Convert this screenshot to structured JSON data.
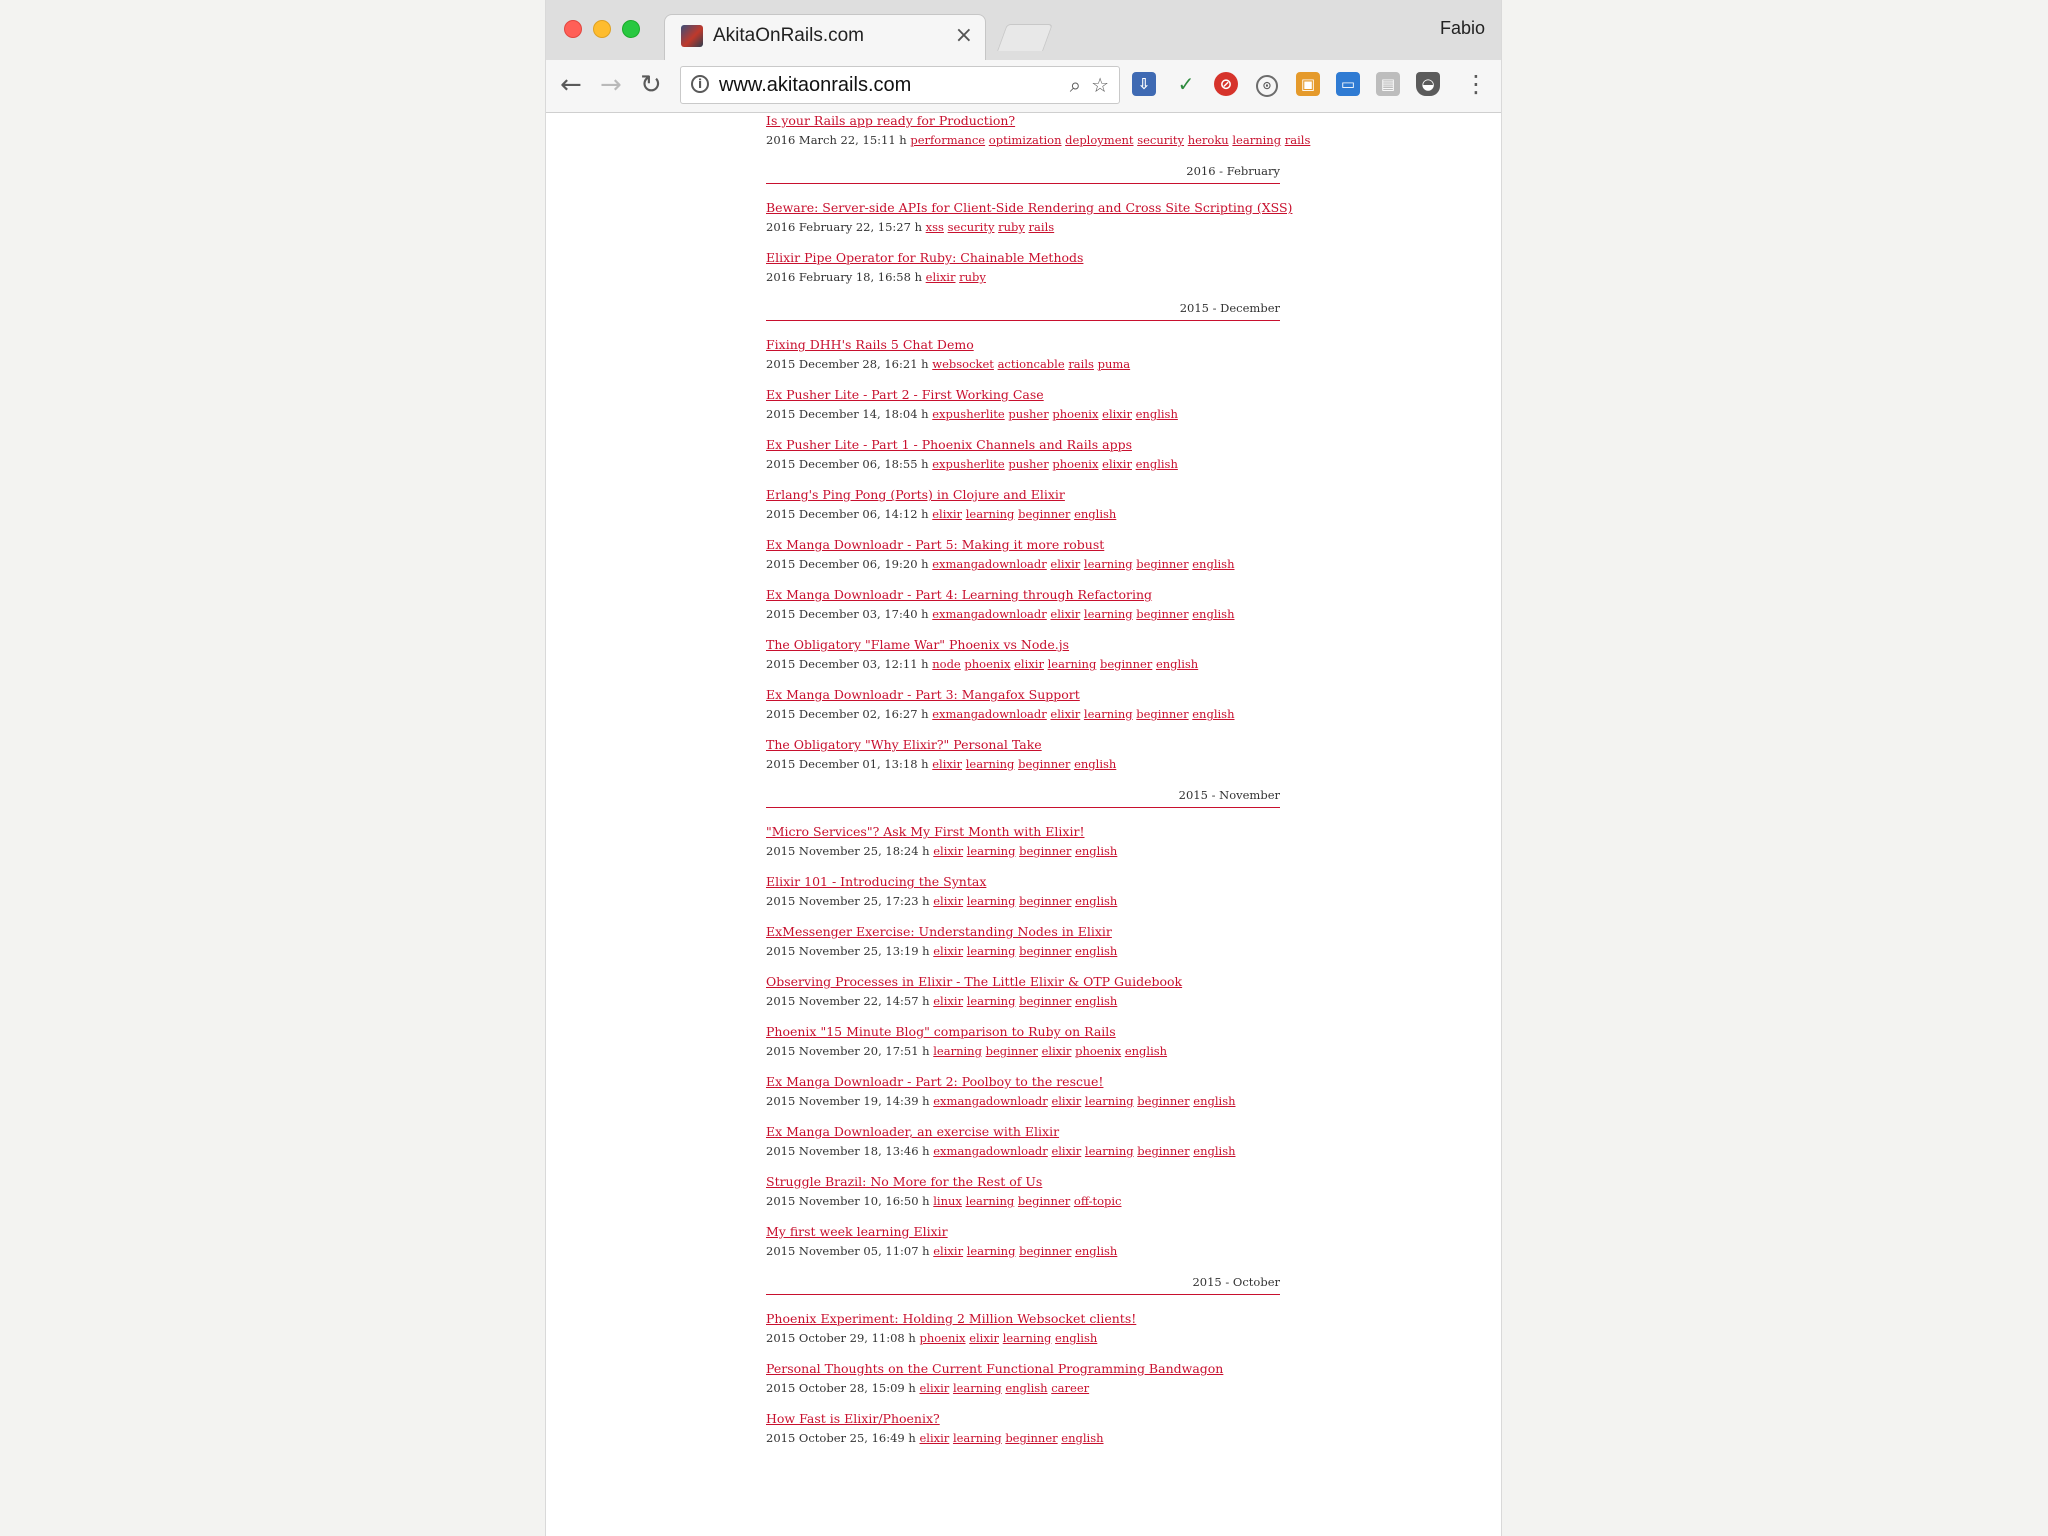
{
  "browser": {
    "tab_title": "AkitaOnRails.com",
    "tab_close": "×",
    "profile": "Fabio",
    "url": "www.akitaonrails.com",
    "nav": {
      "back": "←",
      "forward": "→",
      "reload": "↻"
    },
    "icons": {
      "info": "i",
      "zoom": "⌕",
      "star": "☆",
      "menu": "⋮"
    },
    "extensions": [
      "⇩",
      "✓",
      "⊘",
      "⊙",
      "▣",
      "▭",
      "▤",
      "◒"
    ]
  },
  "content": {
    "first_post": {
      "title": "Is your Rails app ready for Production?",
      "date": "2016 March 22, 15:11 h",
      "tags": [
        "performance",
        "optimization",
        "deployment",
        "security",
        "heroku",
        "learning",
        "rails"
      ]
    },
    "months": [
      {
        "label": "2016 - February",
        "posts": [
          {
            "title": "Beware: Server-side APIs for Client-Side Rendering and Cross Site Scripting (XSS)",
            "date": "2016 February 22, 15:27 h",
            "tags": [
              "xss",
              "security",
              "ruby",
              "rails"
            ]
          },
          {
            "title": "Elixir Pipe Operator for Ruby: Chainable Methods",
            "date": "2016 February 18, 16:58 h",
            "tags": [
              "elixir",
              "ruby"
            ]
          }
        ]
      },
      {
        "label": "2015 - December",
        "posts": [
          {
            "title": "Fixing DHH's Rails 5 Chat Demo",
            "date": "2015 December 28, 16:21 h",
            "tags": [
              "websocket",
              "actioncable",
              "rails",
              "puma"
            ]
          },
          {
            "title": "Ex Pusher Lite - Part 2 - First Working Case",
            "date": "2015 December 14, 18:04 h",
            "tags": [
              "expusherlite",
              "pusher",
              "phoenix",
              "elixir",
              "english"
            ]
          },
          {
            "title": "Ex Pusher Lite - Part 1 - Phoenix Channels and Rails apps",
            "date": "2015 December 06, 18:55 h",
            "tags": [
              "expusherlite",
              "pusher",
              "phoenix",
              "elixir",
              "english"
            ]
          },
          {
            "title": "Erlang's Ping Pong (Ports) in Clojure and Elixir",
            "date": "2015 December 06, 14:12 h",
            "tags": [
              "elixir",
              "learning",
              "beginner",
              "english"
            ]
          },
          {
            "title": "Ex Manga Downloadr - Part 5: Making it more robust",
            "date": "2015 December 06, 19:20 h",
            "tags": [
              "exmangadownloadr",
              "elixir",
              "learning",
              "beginner",
              "english"
            ]
          },
          {
            "title": "Ex Manga Downloadr - Part 4: Learning through Refactoring",
            "date": "2015 December 03, 17:40 h",
            "tags": [
              "exmangadownloadr",
              "elixir",
              "learning",
              "beginner",
              "english"
            ]
          },
          {
            "title": "The Obligatory \"Flame War\" Phoenix vs Node.js",
            "date": "2015 December 03, 12:11 h",
            "tags": [
              "node",
              "phoenix",
              "elixir",
              "learning",
              "beginner",
              "english"
            ]
          },
          {
            "title": "Ex Manga Downloadr - Part 3: Mangafox Support",
            "date": "2015 December 02, 16:27 h",
            "tags": [
              "exmangadownloadr",
              "elixir",
              "learning",
              "beginner",
              "english"
            ]
          },
          {
            "title": "The Obligatory \"Why Elixir?\" Personal Take",
            "date": "2015 December 01, 13:18 h",
            "tags": [
              "elixir",
              "learning",
              "beginner",
              "english"
            ]
          }
        ]
      },
      {
        "label": "2015 - November",
        "posts": [
          {
            "title": "\"Micro Services\"? Ask My First Month with Elixir!",
            "date": "2015 November 25, 18:24 h",
            "tags": [
              "elixir",
              "learning",
              "beginner",
              "english"
            ]
          },
          {
            "title": "Elixir 101 - Introducing the Syntax",
            "date": "2015 November 25, 17:23 h",
            "tags": [
              "elixir",
              "learning",
              "beginner",
              "english"
            ]
          },
          {
            "title": "ExMessenger Exercise: Understanding Nodes in Elixir",
            "date": "2015 November 25, 13:19 h",
            "tags": [
              "elixir",
              "learning",
              "beginner",
              "english"
            ]
          },
          {
            "title": "Observing Processes in Elixir - The Little Elixir & OTP Guidebook",
            "date": "2015 November 22, 14:57 h",
            "tags": [
              "elixir",
              "learning",
              "beginner",
              "english"
            ]
          },
          {
            "title": "Phoenix \"15 Minute Blog\" comparison to Ruby on Rails",
            "date": "2015 November 20, 17:51 h",
            "tags": [
              "learning",
              "beginner",
              "elixir",
              "phoenix",
              "english"
            ]
          },
          {
            "title": "Ex Manga Downloadr - Part 2: Poolboy to the rescue!",
            "date": "2015 November 19, 14:39 h",
            "tags": [
              "exmangadownloadr",
              "elixir",
              "learning",
              "beginner",
              "english"
            ]
          },
          {
            "title": "Ex Manga Downloader, an exercise with Elixir",
            "date": "2015 November 18, 13:46 h",
            "tags": [
              "exmangadownloadr",
              "elixir",
              "learning",
              "beginner",
              "english"
            ]
          },
          {
            "title": "Struggle Brazil: No More for the Rest of Us",
            "date": "2015 November 10, 16:50 h",
            "tags": [
              "linux",
              "learning",
              "beginner",
              "off-topic"
            ]
          },
          {
            "title": "My first week learning Elixir",
            "date": "2015 November 05, 11:07 h",
            "tags": [
              "elixir",
              "learning",
              "beginner",
              "english"
            ]
          }
        ]
      },
      {
        "label": "2015 - October",
        "posts": [
          {
            "title": "Phoenix Experiment: Holding 2 Million Websocket clients!",
            "date": "2015 October 29, 11:08 h",
            "tags": [
              "phoenix",
              "elixir",
              "learning",
              "english"
            ]
          },
          {
            "title": "Personal Thoughts on the Current Functional Programming Bandwagon",
            "date": "2015 October 28, 15:09 h",
            "tags": [
              "elixir",
              "learning",
              "english",
              "career"
            ]
          },
          {
            "title": "How Fast is Elixir/Phoenix?",
            "date": "2015 October 25, 16:49 h",
            "tags": [
              "elixir",
              "learning",
              "beginner",
              "english"
            ]
          }
        ]
      }
    ]
  }
}
